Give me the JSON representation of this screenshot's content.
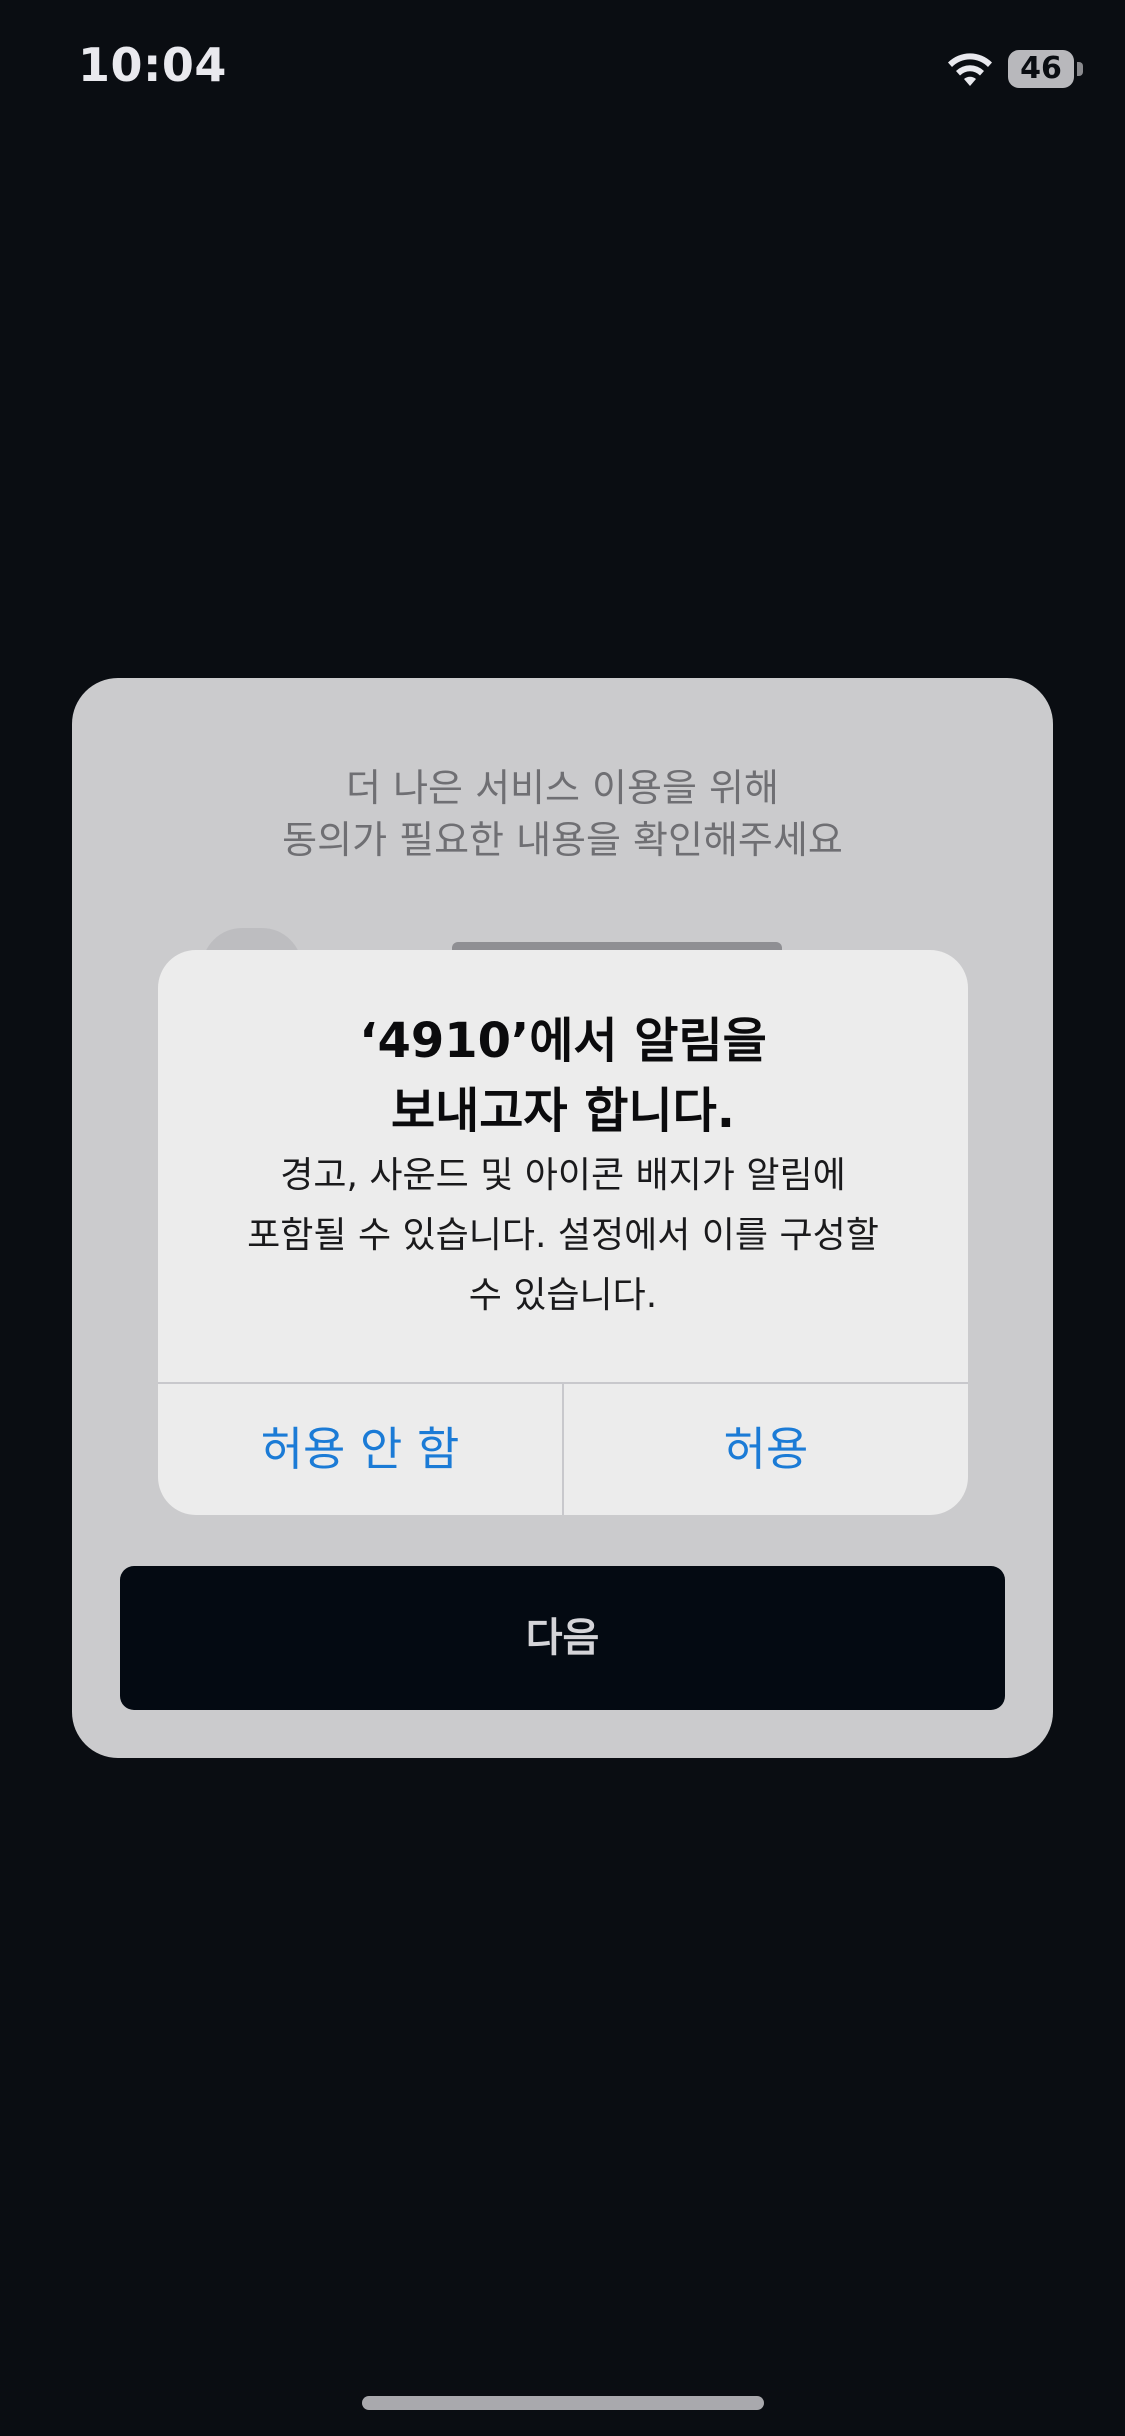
{
  "status_bar": {
    "time": "10:04",
    "battery": "46",
    "wifi_icon": "wifi-icon"
  },
  "consent_card": {
    "subtitle_line1": "더 나은 서비스 이용을 위해",
    "subtitle_line2": "동의가 필요한 내용을 확인해주세요",
    "next_button": "다음"
  },
  "alert": {
    "title_line1": "‘4910’에서 알림을",
    "title_line2": "보내고자 합니다.",
    "message_line1": "경고, 사운드 및 아이콘 배지가 알림에",
    "message_line2": "포함될 수 있습니다. 설정에서 이를 구성할",
    "message_line3": "수 있습니다.",
    "deny_label": "허용 안 함",
    "allow_label": "허용",
    "button_color": "#1b7bd6"
  }
}
